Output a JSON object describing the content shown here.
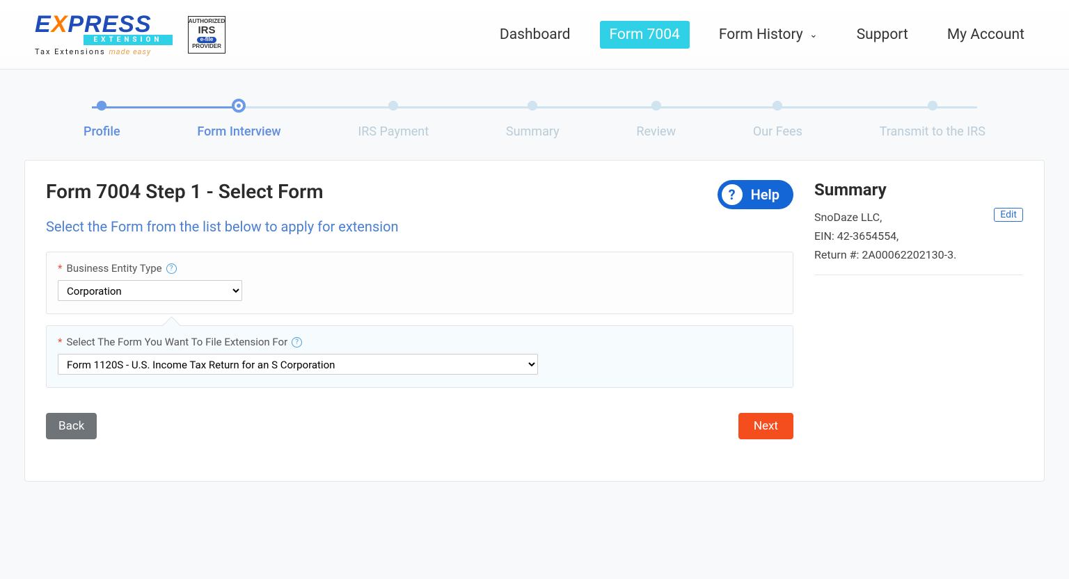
{
  "header": {
    "logo": {
      "brand_prefix": "E",
      "brand_x": "X",
      "brand_suffix": "PRESS",
      "extension_bar": "EXTENSION",
      "tagline_prefix": "Tax Extensions",
      "tagline_suffix": "made easy"
    },
    "irs": {
      "line1": "AUTHORIZED",
      "line2": "IRS",
      "line3": "e-file",
      "line4": "PROVIDER"
    },
    "nav": {
      "dashboard": "Dashboard",
      "form7004": "Form 7004",
      "form_history": "Form History",
      "support": "Support",
      "my_account": "My Account"
    }
  },
  "stepper": {
    "steps": [
      "Profile",
      "Form Interview",
      "IRS Payment",
      "Summary",
      "Review",
      "Our Fees",
      "Transmit to the IRS"
    ]
  },
  "main": {
    "title": "Form 7004 Step 1 - Select Form",
    "help_label": "Help",
    "subtitle": "Select the Form from the list below to apply for extension",
    "field1": {
      "label": "Business Entity Type",
      "value": "Corporation"
    },
    "field2": {
      "label": "Select The Form You Want To File Extension For",
      "value": "Form 1120S - U.S. Income Tax Return for an S Corporation"
    },
    "back": "Back",
    "next": "Next"
  },
  "summary": {
    "title": "Summary",
    "edit": "Edit",
    "company": "SnoDaze LLC,",
    "ein": "EIN: 42-3654554,",
    "return_no": "Return #: 2A00062202130-3."
  }
}
